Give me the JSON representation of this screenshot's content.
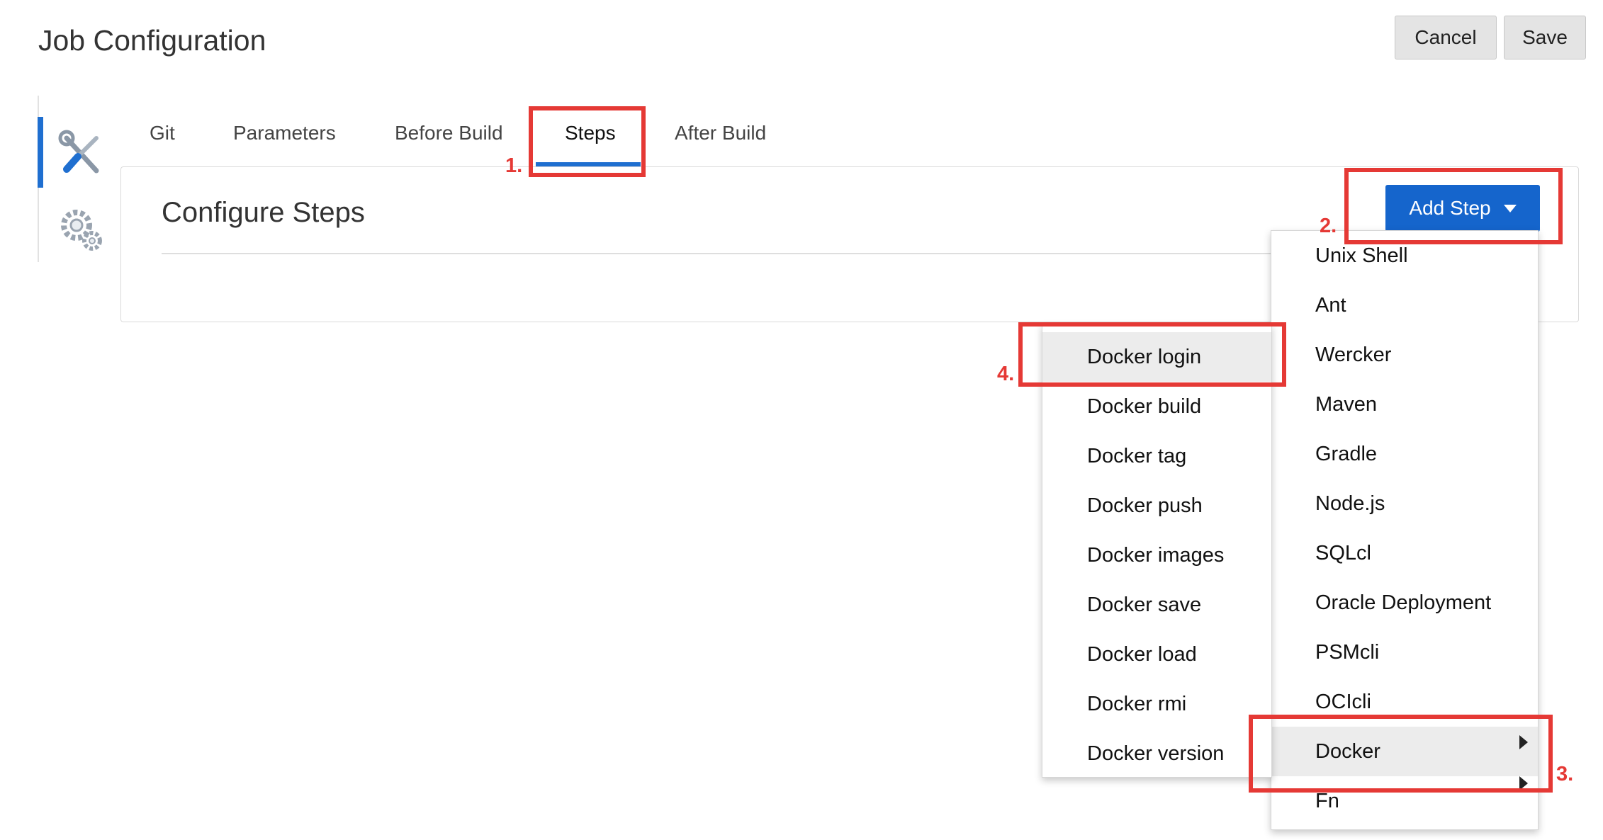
{
  "page": {
    "title": "Job Configuration"
  },
  "header": {
    "cancel_label": "Cancel",
    "save_label": "Save"
  },
  "sidebar": {
    "items": [
      {
        "icon": "tools-icon",
        "active": true
      },
      {
        "icon": "gears-icon",
        "active": false
      }
    ]
  },
  "tabs": [
    {
      "label": "Git",
      "active": false
    },
    {
      "label": "Parameters",
      "active": false
    },
    {
      "label": "Before Build",
      "active": false
    },
    {
      "label": "Steps",
      "active": true
    },
    {
      "label": "After Build",
      "active": false
    }
  ],
  "panel": {
    "title": "Configure Steps",
    "add_step_label": "Add Step"
  },
  "step_menu": {
    "items": [
      "Unix Shell",
      "Ant",
      "Wercker",
      "Maven",
      "Gradle",
      "Node.js",
      "SQLcl",
      "Oracle Deployment",
      "PSMcli",
      "OCIcli",
      "Docker",
      "Fn"
    ],
    "highlighted": "Docker"
  },
  "docker_submenu": {
    "items": [
      "Docker login",
      "Docker build",
      "Docker tag",
      "Docker push",
      "Docker images",
      "Docker save",
      "Docker load",
      "Docker rmi",
      "Docker version"
    ],
    "highlighted": "Docker login"
  },
  "callouts": [
    "1.",
    "2.",
    "3.",
    "4."
  ],
  "colors": {
    "accent": "#1565cc",
    "highlight": "#e53935"
  }
}
